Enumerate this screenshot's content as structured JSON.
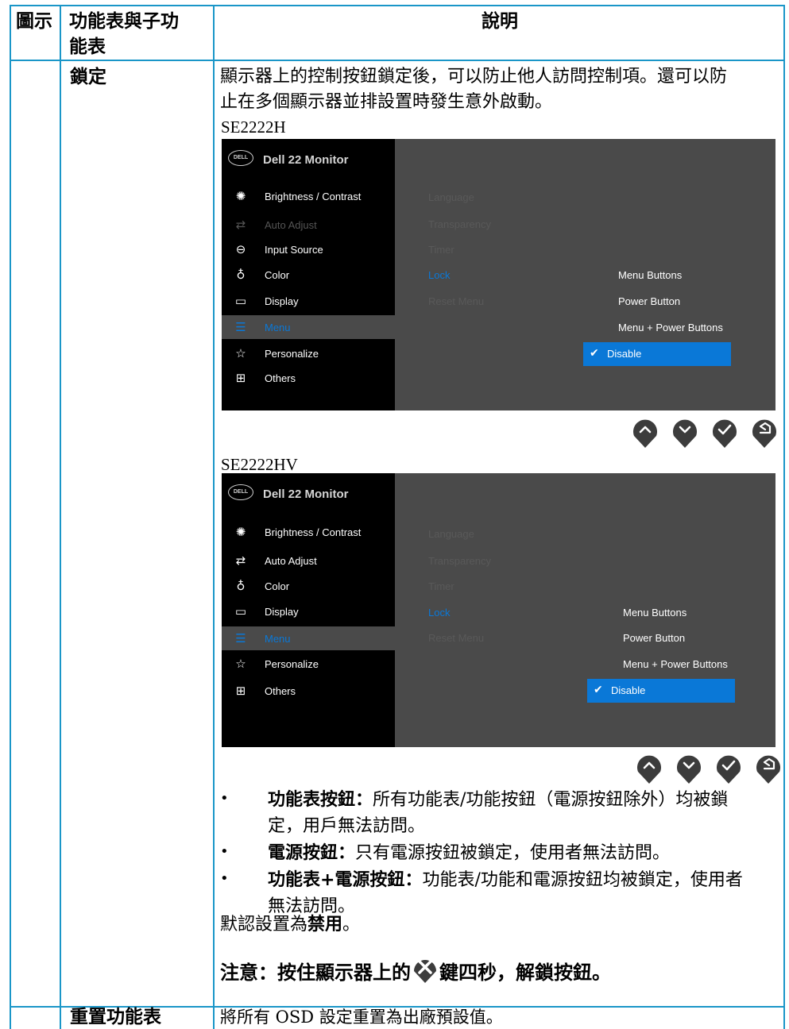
{
  "header": {
    "col1": "圖示",
    "col2_line1": "功能表與子功",
    "col2_line2": "能表",
    "col3": "說明"
  },
  "lock_row": {
    "name": "鎖定",
    "intro_line1": "顯示器上的控制按鈕鎖定後，可以防止他人訪問控制項。還可以防",
    "intro_line2": "止在多個顯示器並排設置時發生意外啟動。",
    "model1": "SE2222H",
    "model2": "SE2222HV"
  },
  "osd1": {
    "logo": "DELL",
    "title": "Dell 22 Monitor",
    "menu": [
      {
        "icon": "brightness-icon",
        "glyph": "✺",
        "label": "Brightness / Contrast"
      },
      {
        "icon": "auto-adjust-icon",
        "glyph": "⇄",
        "label": "Auto Adjust"
      },
      {
        "icon": "input-source-icon",
        "glyph": "⊖",
        "label": "Input Source"
      },
      {
        "icon": "color-icon",
        "glyph": "♁",
        "label": "Color"
      },
      {
        "icon": "display-icon",
        "glyph": "▭",
        "label": "Display"
      },
      {
        "icon": "menu-icon",
        "glyph": "☰",
        "label": "Menu"
      },
      {
        "icon": "personalize-icon",
        "glyph": "☆",
        "label": "Personalize"
      },
      {
        "icon": "others-icon",
        "glyph": "⊞",
        "label": "Others"
      }
    ],
    "submenu": [
      "Language",
      "Transparency",
      "Timer",
      "Lock",
      "Reset Menu"
    ],
    "options": [
      "Menu Buttons",
      "Power Button",
      "Menu + Power Buttons"
    ],
    "selected_option": "Disable"
  },
  "osd2": {
    "logo": "DELL",
    "title": "Dell 22 Monitor",
    "menu": [
      {
        "icon": "brightness-icon",
        "glyph": "✺",
        "label": "Brightness / Contrast"
      },
      {
        "icon": "auto-adjust-icon",
        "glyph": "⇄",
        "label": "Auto Adjust"
      },
      {
        "icon": "color-icon",
        "glyph": "♁",
        "label": "Color"
      },
      {
        "icon": "display-icon",
        "glyph": "▭",
        "label": "Display"
      },
      {
        "icon": "menu-icon",
        "glyph": "☰",
        "label": "Menu"
      },
      {
        "icon": "personalize-icon",
        "glyph": "☆",
        "label": "Personalize"
      },
      {
        "icon": "others-icon",
        "glyph": "⊞",
        "label": "Others"
      }
    ],
    "submenu": [
      "Language",
      "Transparency",
      "Timer",
      "Lock",
      "Reset Menu"
    ],
    "options": [
      "Menu Buttons",
      "Power Button",
      "Menu + Power Buttons"
    ],
    "selected_option": "Disable"
  },
  "buttons": [
    "up-icon",
    "down-icon",
    "check-icon",
    "back-icon"
  ],
  "bullets": [
    {
      "term": "功能表按鈕：",
      "line1": "所有功能表/功能按鈕（電源按鈕除外）均被鎖",
      "line2": "定，用戶無法訪問。"
    },
    {
      "term": "電源按鈕：",
      "line1": "只有電源按鈕被鎖定，使用者無法訪問。",
      "line2": ""
    },
    {
      "term": "功能表+電源按鈕：",
      "line1": "功能表/功能和電源按鈕均被鎖定，使用者",
      "line2": "無法訪問。"
    }
  ],
  "default_prefix": "默認設置為",
  "default_value": "禁用",
  "default_suffix": "。",
  "note_prefix": "注意：按住顯示器上的",
  "note_suffix": "鍵四秒，解鎖按鈕。",
  "reset_row": {
    "name": "重置功能表",
    "desc": "將所有 OSD 設定重置為出廠預設值。"
  },
  "colors": {
    "border": "#1a96c8",
    "accent": "#0a78d7"
  }
}
